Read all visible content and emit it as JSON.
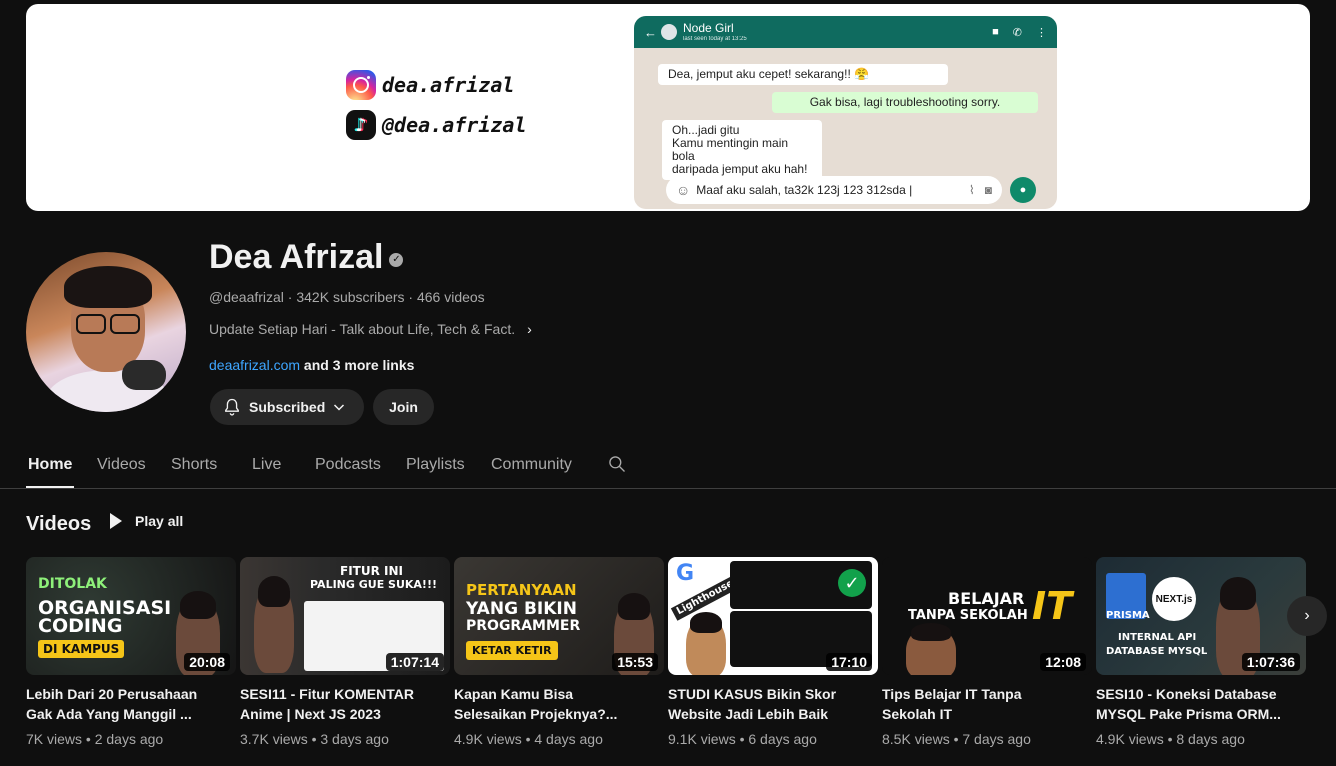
{
  "banner": {
    "instagram": "dea.afrizal",
    "tiktok": "@dea.afrizal",
    "chat": {
      "contact": "Node Girl",
      "status": "last seen today at 13:25",
      "messages": [
        "Dea, jemput aku cepet! sekarang!! 😤",
        "Gak bisa, lagi troubleshooting sorry.",
        "Oh...jadi gitu\nKamu mentingin main bola\ndaripada jemput aku hah!"
      ],
      "input_text": "Maaf aku salah, ta32k 123j 123 312sda  |"
    }
  },
  "channel": {
    "name": "Dea Afrizal",
    "meta": "@deaafrizal · 342K subscribers · 466 videos",
    "description": "Update Setiap Hari - Talk about Life, Tech & Fact.",
    "link": "deaafrizal.com",
    "more_links": " and 3 more links",
    "subscribe_label": "Subscribed",
    "join_label": "Join"
  },
  "tabs": [
    "Home",
    "Videos",
    "Shorts",
    "Live",
    "Podcasts",
    "Playlists",
    "Community"
  ],
  "section": {
    "title": "Videos",
    "play_all": "Play all"
  },
  "videos": [
    {
      "title": "Lebih Dari 20 Perusahaan\nGak Ada Yang Manggil ...",
      "meta": "7K views • 2 days ago",
      "duration": "20:08",
      "thumb_text": [
        "DITOLAK",
        "ORGANISASI",
        "CODING",
        "DI KAMPUS"
      ]
    },
    {
      "title": "SESI11 - Fitur KOMENTAR\nAnime | Next JS 2023",
      "meta": "3.7K views • 3 days ago",
      "duration": "1:07:14",
      "thumb_text": [
        "FITUR INI",
        "PALING GUE SUKA!!!"
      ]
    },
    {
      "title": "Kapan Kamu Bisa\nSelesaikan Projeknya?...",
      "meta": "4.9K views • 4 days ago",
      "duration": "15:53",
      "thumb_text": [
        "PERTANYAAN",
        "YANG BIKIN",
        "PROGRAMMER",
        "KETAR KETIR"
      ]
    },
    {
      "title": "STUDI KASUS Bikin Skor\nWebsite Jadi Lebih Baik",
      "meta": "9.1K views • 6 days ago",
      "duration": "17:10",
      "thumb_text": [
        "Lighthouse"
      ]
    },
    {
      "title": "Tips Belajar IT Tanpa\nSekolah IT",
      "meta": "8.5K views • 7 days ago",
      "duration": "12:08",
      "thumb_text": [
        "BELAJAR",
        "TANPA SEKOLAH",
        "IT"
      ]
    },
    {
      "title": "SESI10 - Koneksi Database\nMYSQL Pake Prisma ORM...",
      "meta": "4.9K views • 8 days ago",
      "duration": "1:07:36",
      "thumb_text": [
        "PRISMA",
        "NEXT.js",
        "INTERNAL API",
        "DATABASE MYSQL"
      ]
    }
  ],
  "colors": {
    "background": "#0f0f0f",
    "link": "#3ea6ff",
    "accent_yellow": "#f5c518"
  }
}
